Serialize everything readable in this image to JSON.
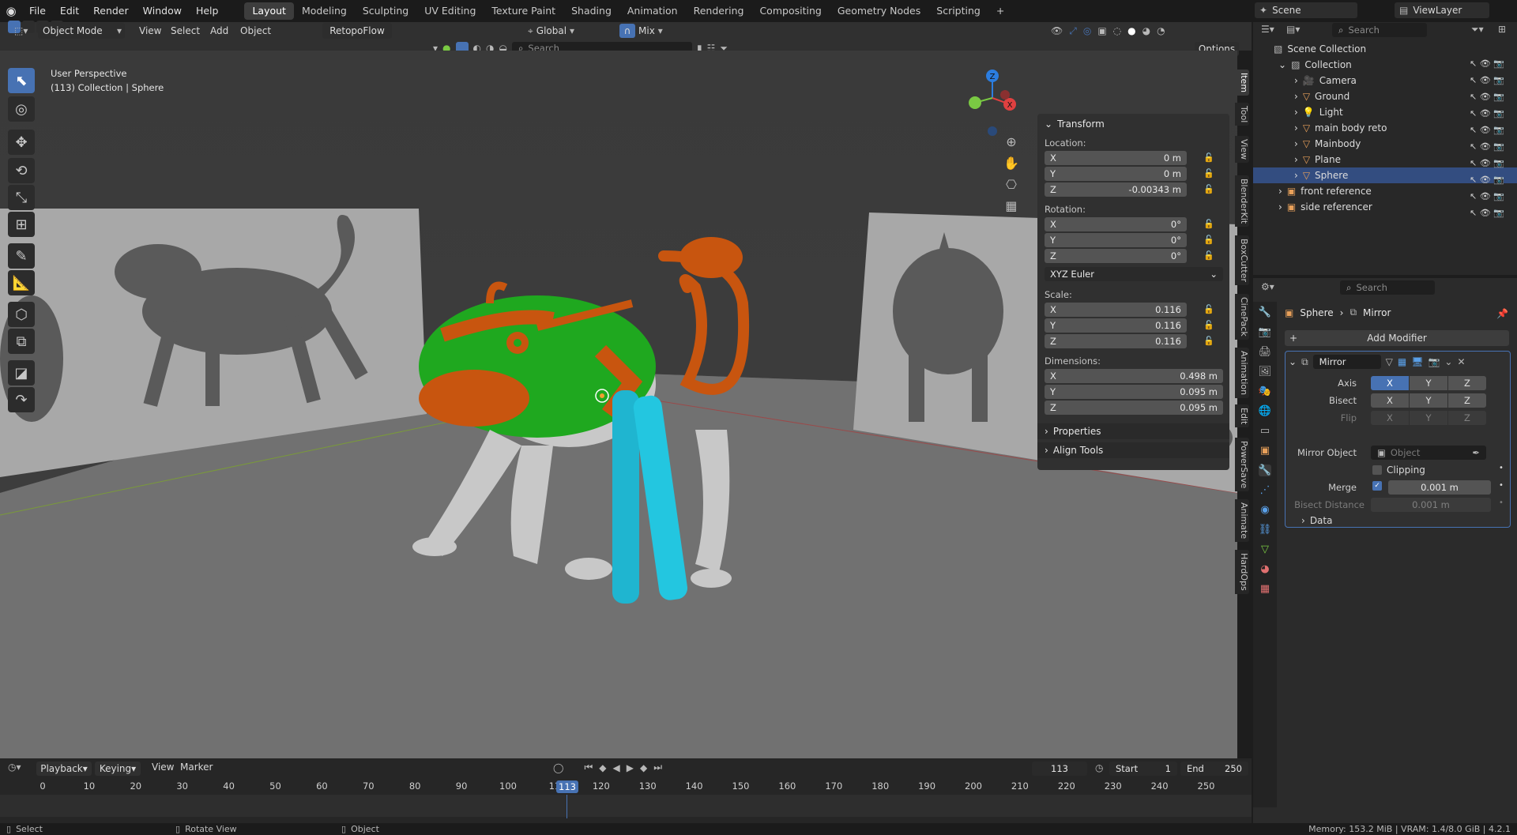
{
  "menubar": {
    "items": [
      "File",
      "Edit",
      "Render",
      "Window",
      "Help"
    ],
    "workspaces": [
      "Layout",
      "Modeling",
      "Sculpting",
      "UV Editing",
      "Texture Paint",
      "Shading",
      "Animation",
      "Rendering",
      "Compositing",
      "Geometry Nodes",
      "Scripting"
    ],
    "active_workspace": "Layout",
    "add_tab": "+",
    "scene": "Scene",
    "view_layer": "ViewLayer"
  },
  "viewport_header": {
    "mode": "Object Mode",
    "menus": [
      "View",
      "Select",
      "Add",
      "Object"
    ],
    "addon": "RetopoFlow",
    "transform": "Global",
    "snap": "Mix",
    "search_placeholder": "Search",
    "options": "Options"
  },
  "viewport": {
    "perspective": "User Perspective",
    "context": "(113) Collection | Sphere",
    "gizmo": {
      "x": "X",
      "y": "Y",
      "z": "Z"
    }
  },
  "npanel": {
    "header": "Transform",
    "location_label": "Location:",
    "location": [
      {
        "axis": "X",
        "value": "0 m"
      },
      {
        "axis": "Y",
        "value": "0 m"
      },
      {
        "axis": "Z",
        "value": "-0.00343 m"
      }
    ],
    "rotation_label": "Rotation:",
    "rotation": [
      {
        "axis": "X",
        "value": "0°"
      },
      {
        "axis": "Y",
        "value": "0°"
      },
      {
        "axis": "Z",
        "value": "0°"
      }
    ],
    "rotation_mode": "XYZ Euler",
    "scale_label": "Scale:",
    "scale": [
      {
        "axis": "X",
        "value": "0.116"
      },
      {
        "axis": "Y",
        "value": "0.116"
      },
      {
        "axis": "Z",
        "value": "0.116"
      }
    ],
    "dimensions_label": "Dimensions:",
    "dimensions": [
      {
        "axis": "X",
        "value": "0.498 m"
      },
      {
        "axis": "Y",
        "value": "0.095 m"
      },
      {
        "axis": "Z",
        "value": "0.095 m"
      }
    ],
    "properties": "Properties",
    "align_tools": "Align Tools",
    "tabs": [
      "Item",
      "Tool",
      "View",
      "BlenderKit",
      "BoxCutter",
      "CinePack",
      "Animation",
      "Edit",
      "PowerSave",
      "Animate",
      "HardOps"
    ]
  },
  "outliner": {
    "search_placeholder": "Search",
    "root": "Scene Collection",
    "collection": "Collection",
    "items": [
      "Camera",
      "Ground",
      "Light",
      "main body reto",
      "Mainbody",
      "Plane",
      "Sphere"
    ],
    "extra": [
      "front reference",
      "side referencer"
    ]
  },
  "properties": {
    "search_placeholder": "Search",
    "breadcrumb_object": "Sphere",
    "breadcrumb_modifier": "Mirror",
    "add_modifier": "Add Modifier",
    "modifier_name": "Mirror",
    "axis_label": "Axis",
    "bisect_label": "Bisect",
    "flip_label": "Flip",
    "xyz": [
      "X",
      "Y",
      "Z"
    ],
    "mirror_object_label": "Mirror Object",
    "mirror_object_placeholder": "Object",
    "clipping_label": "Clipping",
    "merge_label": "Merge",
    "merge_value": "0.001 m",
    "bisect_distance_label": "Bisect Distance",
    "bisect_distance_value": "0.001 m",
    "data_label": "Data"
  },
  "timeline": {
    "menus": [
      "Playback",
      "Keying",
      "View",
      "Marker"
    ],
    "current_frame": "113",
    "start_label": "Start",
    "start": "1",
    "end_label": "End",
    "end": "250",
    "ticks": [
      "0",
      "10",
      "20",
      "30",
      "40",
      "50",
      "60",
      "70",
      "80",
      "90",
      "100",
      "11",
      "120",
      "130",
      "140",
      "150",
      "160",
      "170",
      "180",
      "190",
      "200",
      "210",
      "220",
      "230",
      "240",
      "250"
    ]
  },
  "statusbar": {
    "select": "Select",
    "rotate": "Rotate View",
    "object": "Object",
    "memory": "Memory: 153.2 MiB | VRAM: 1.4/8.0 GiB | 4.2.1"
  }
}
